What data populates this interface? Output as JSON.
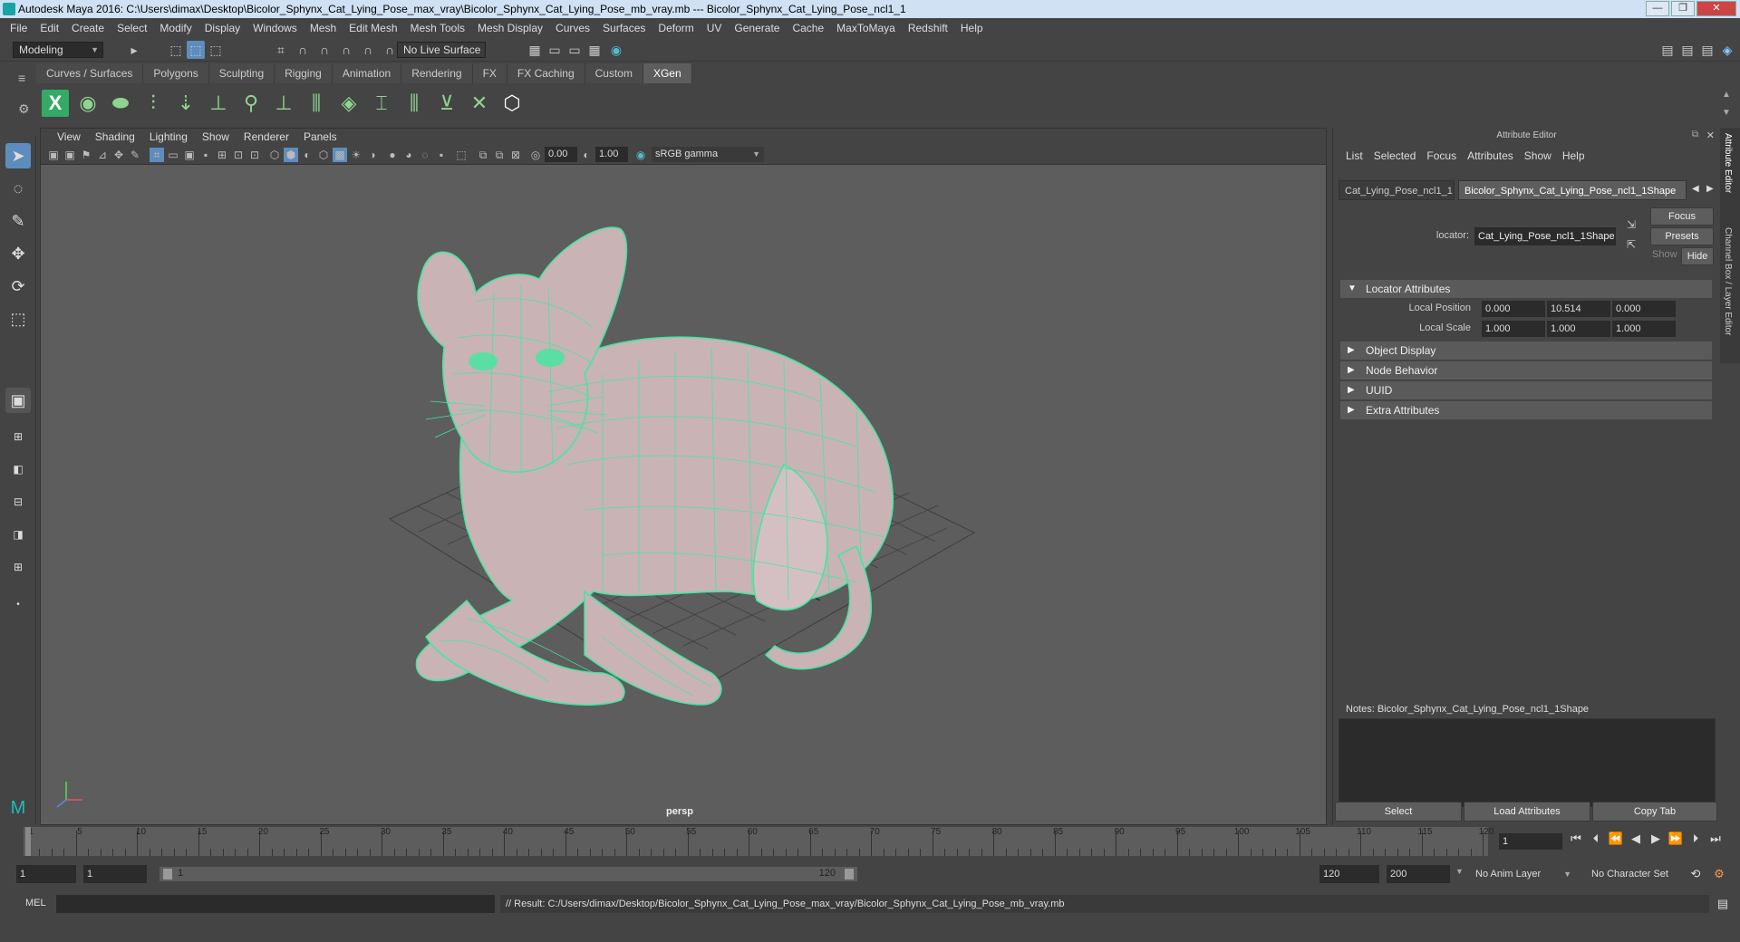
{
  "window": {
    "title": "Autodesk Maya 2016: C:\\Users\\dimax\\Desktop\\Bicolor_Sphynx_Cat_Lying_Pose_max_vray\\Bicolor_Sphynx_Cat_Lying_Pose_mb_vray.mb   ---   Bicolor_Sphynx_Cat_Lying_Pose_ncl1_1",
    "minimize": "—",
    "maximize": "❐",
    "close": "✕"
  },
  "menubar": [
    "File",
    "Edit",
    "Create",
    "Select",
    "Modify",
    "Display",
    "Windows",
    "Mesh",
    "Edit Mesh",
    "Mesh Tools",
    "Mesh Display",
    "Curves",
    "Surfaces",
    "Deform",
    "UV",
    "Generate",
    "Cache",
    "MaxToMaya",
    "Redshift",
    "Help"
  ],
  "statusline": {
    "mode": "Modeling",
    "live_surface": "No Live Surface"
  },
  "shelf_tabs": [
    "Curves / Surfaces",
    "Polygons",
    "Sculpting",
    "Rigging",
    "Animation",
    "Rendering",
    "FX",
    "FX Caching",
    "Custom",
    "XGen"
  ],
  "shelf_active": "XGen",
  "viewport": {
    "menu": [
      "View",
      "Shading",
      "Lighting",
      "Show",
      "Renderer",
      "Panels"
    ],
    "exposure": "0.00",
    "gamma": "1.00",
    "color_space": "sRGB gamma",
    "camera": "persp"
  },
  "attribute_editor": {
    "title": "Attribute Editor",
    "menu": [
      "List",
      "Selected",
      "Focus",
      "Attributes",
      "Show",
      "Help"
    ],
    "tabs": [
      "Cat_Lying_Pose_ncl1_1",
      "Bicolor_Sphynx_Cat_Lying_Pose_ncl1_1Shape"
    ],
    "locator_label": "locator:",
    "locator_value": "Cat_Lying_Pose_ncl1_1Shape",
    "focus_btn": "Focus",
    "presets_btn": "Presets",
    "show_btn": "Show",
    "hide_btn": "Hide",
    "sections": {
      "locator": "Locator Attributes",
      "object_display": "Object Display",
      "node_behavior": "Node Behavior",
      "uuid": "UUID",
      "extra": "Extra Attributes"
    },
    "local_position_label": "Local Position",
    "local_position": [
      "0.000",
      "10.514",
      "0.000"
    ],
    "local_scale_label": "Local Scale",
    "local_scale": [
      "1.000",
      "1.000",
      "1.000"
    ],
    "notes_label": "Notes:  Bicolor_Sphynx_Cat_Lying_Pose_ncl1_1Shape",
    "select_btn": "Select",
    "load_btn": "Load Attributes",
    "copy_btn": "Copy Tab"
  },
  "side_tabs": [
    "Attribute Editor",
    "Channel Box / Layer Editor"
  ],
  "timeslider": {
    "labels": [
      "1",
      "5",
      "10",
      "15",
      "20",
      "25",
      "30",
      "35",
      "40",
      "45",
      "50",
      "55",
      "60",
      "65",
      "70",
      "75",
      "80",
      "85",
      "90",
      "95",
      "100",
      "105",
      "110",
      "115",
      "120"
    ],
    "current_frame": "1"
  },
  "rangeslider": {
    "start": "1",
    "anim_start": "1",
    "range_start": "1",
    "range_end": "120",
    "end": "120",
    "anim_end": "200",
    "anim_layer": "No Anim Layer",
    "character_set": "No Character Set"
  },
  "cmdline": {
    "lang": "MEL",
    "result": "// Result: C:/Users/dimax/Desktop/Bicolor_Sphynx_Cat_Lying_Pose_max_vray/Bicolor_Sphynx_Cat_Lying_Pose_mb_vray.mb"
  },
  "colors": {
    "wireframe": "#3ee8a0",
    "mesh": "#c9b3b5",
    "viewport_bg": "#5d5d5d"
  }
}
